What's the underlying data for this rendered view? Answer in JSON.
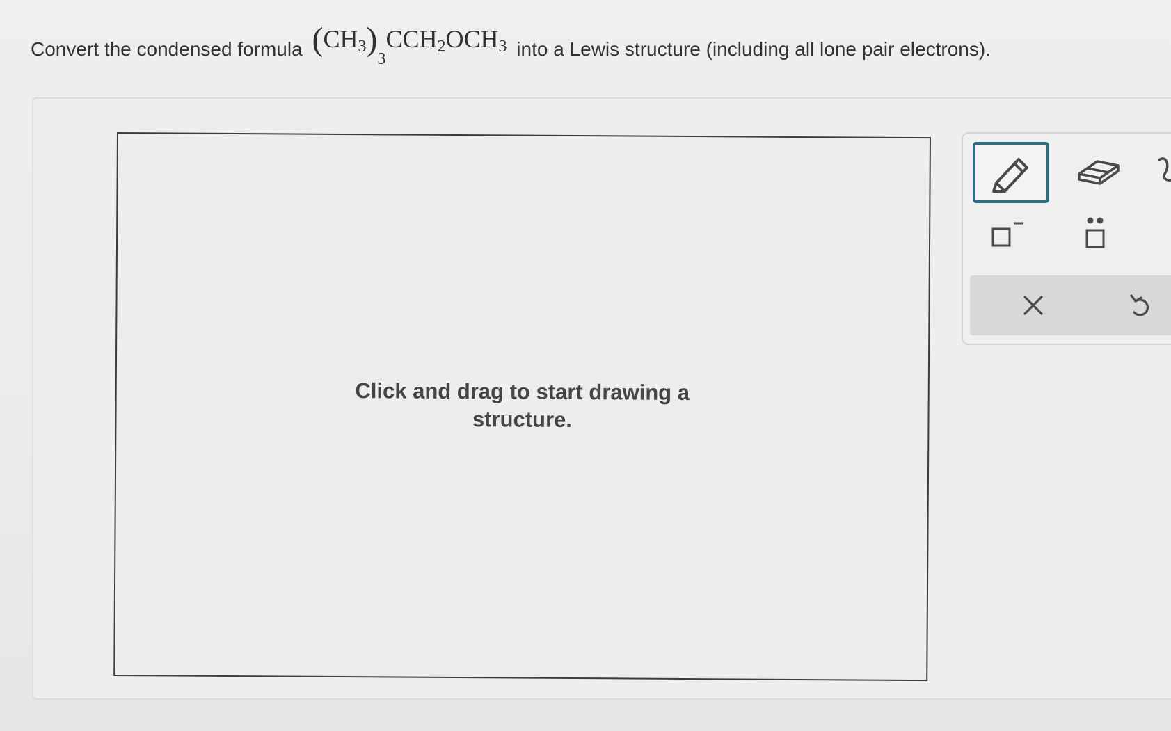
{
  "question": {
    "prefix": "Convert the condensed formula",
    "suffix": "into a Lewis structure (including all lone pair electrons).",
    "formula": {
      "group": "CH",
      "group_sub": "3",
      "group_multiplier": "3",
      "rest_1": "CCH",
      "rest_1_sub": "2",
      "rest_2": "OCH",
      "rest_2_sub": "3"
    }
  },
  "canvas": {
    "hint_line1": "Click and drag to start drawing a",
    "hint_line2": "structure."
  },
  "toolbar": {
    "tools": [
      {
        "name": "pencil",
        "icon": "pencil-icon",
        "selected": true
      },
      {
        "name": "eraser",
        "icon": "eraser-icon",
        "selected": false
      },
      {
        "name": "partial-tool",
        "icon": "partial-tool-icon",
        "selected": false
      },
      {
        "name": "negative-charge",
        "icon": "negative-charge-icon",
        "selected": false
      },
      {
        "name": "lone-pair",
        "icon": "lone-pair-icon",
        "selected": false
      }
    ],
    "actions": [
      {
        "name": "clear",
        "icon": "close-icon"
      },
      {
        "name": "undo",
        "icon": "undo-icon"
      }
    ]
  },
  "colors": {
    "accent": "#2b6f86",
    "icon": "#4a4a4a",
    "canvas_border": "#3c3c3c"
  }
}
